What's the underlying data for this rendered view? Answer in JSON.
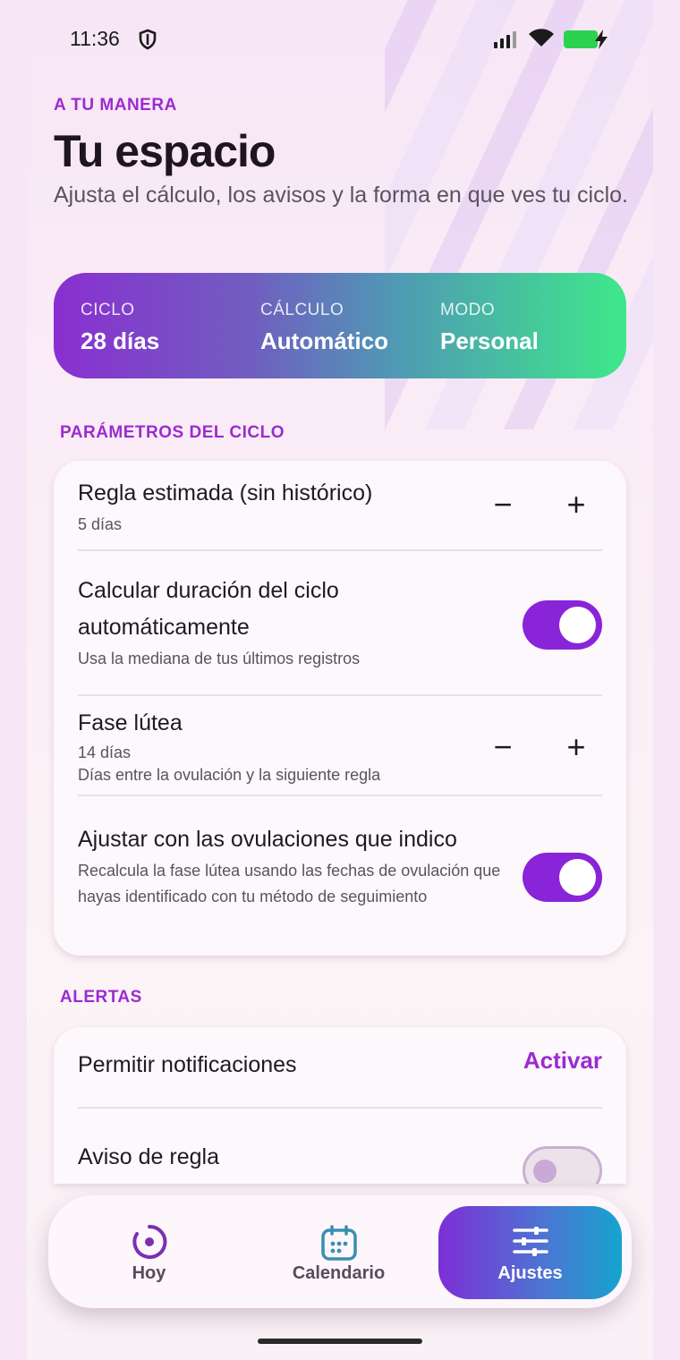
{
  "status_bar": {
    "time": "11:36"
  },
  "header": {
    "kicker": "A TU MANERA",
    "title": "Tu espacio",
    "subtitle": "Ajusta el cálculo, los avisos y la forma en que ves tu ciclo."
  },
  "summary": {
    "items": [
      {
        "label": "CICLO",
        "value": "28 días"
      },
      {
        "label": "CÁLCULO",
        "value": "Automático"
      },
      {
        "label": "MODO",
        "value": "Personal"
      }
    ]
  },
  "cycle_section": {
    "label": "PARÁMETROS DEL CICLO",
    "rows": {
      "period": {
        "title": "Regla estimada (sin histórico)",
        "value": "5 días",
        "minus": "−",
        "plus": "+"
      },
      "auto_calc": {
        "title": "Calcular duración del ciclo automáticamente",
        "subtitle": "Usa la mediana de tus últimos registros",
        "enabled": true
      },
      "luteal": {
        "title": "Fase lútea",
        "value": "14 días",
        "subtitle": "Días entre la ovulación y la siguiente regla",
        "minus": "−",
        "plus": "+"
      },
      "ovulation": {
        "title": "Ajustar con las ovulaciones que indico",
        "subtitle": "Recalcula la fase lútea usando las fechas de ovulación que hayas identificado con tu método de seguimiento",
        "enabled": true
      }
    }
  },
  "alerts_section": {
    "label": "ALERTAS",
    "rows": {
      "notifications": {
        "title": "Permitir notificaciones",
        "action": "Activar"
      },
      "period_alert": {
        "title": "Aviso de regla",
        "enabled": false
      }
    }
  },
  "nav": {
    "items": [
      {
        "label": "Hoy",
        "icon": "target-icon"
      },
      {
        "label": "Calendario",
        "icon": "calendar-icon"
      },
      {
        "label": "Ajustes",
        "icon": "sliders-icon",
        "active": true
      }
    ]
  },
  "colors": {
    "accent": "#9b2bd0",
    "toggle_on": "#8a24d8"
  }
}
